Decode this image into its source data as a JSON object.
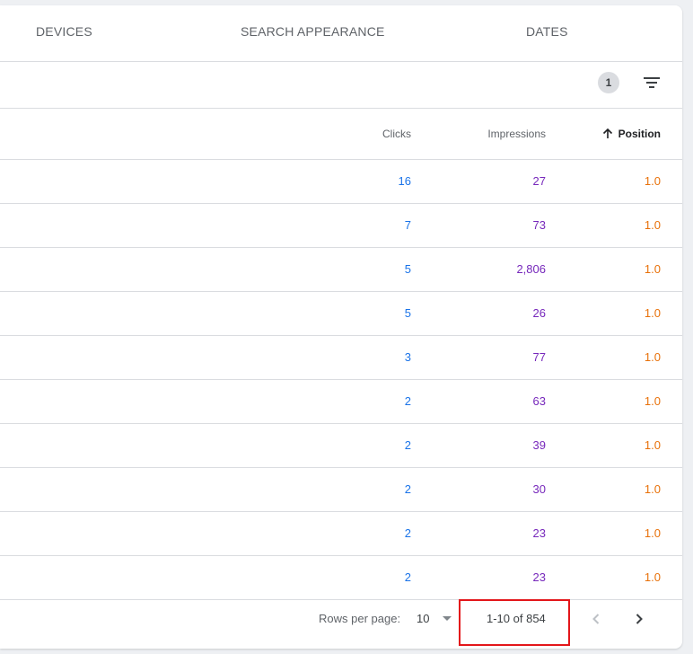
{
  "tabs": [
    {
      "label": "DEVICES"
    },
    {
      "label": "SEARCH APPEARANCE"
    },
    {
      "label": "DATES"
    }
  ],
  "filter": {
    "active_count": "1",
    "icon": "filter-icon"
  },
  "table": {
    "columns": {
      "clicks": "Clicks",
      "impressions": "Impressions",
      "position": "Position"
    },
    "sort": {
      "column": "position",
      "direction": "ascending",
      "icon": "arrow-up-icon"
    },
    "rows": [
      {
        "clicks": "16",
        "impressions": "27",
        "position": "1.0"
      },
      {
        "clicks": "7",
        "impressions": "73",
        "position": "1.0"
      },
      {
        "clicks": "5",
        "impressions": "2,806",
        "position": "1.0"
      },
      {
        "clicks": "5",
        "impressions": "26",
        "position": "1.0"
      },
      {
        "clicks": "3",
        "impressions": "77",
        "position": "1.0"
      },
      {
        "clicks": "2",
        "impressions": "63",
        "position": "1.0"
      },
      {
        "clicks": "2",
        "impressions": "39",
        "position": "1.0"
      },
      {
        "clicks": "2",
        "impressions": "30",
        "position": "1.0"
      },
      {
        "clicks": "2",
        "impressions": "23",
        "position": "1.0"
      },
      {
        "clicks": "2",
        "impressions": "23",
        "position": "1.0"
      }
    ]
  },
  "pagination": {
    "rows_per_page_label": "Rows per page:",
    "rows_per_page_value": "10",
    "range_text": "1-10 of 854",
    "prev_icon": "chevron-left-icon",
    "next_icon": "chevron-right-icon"
  },
  "colors": {
    "clicks": "#1a73e8",
    "impressions": "#7627bb",
    "position": "#e8710a",
    "highlight": "#e3161a"
  }
}
